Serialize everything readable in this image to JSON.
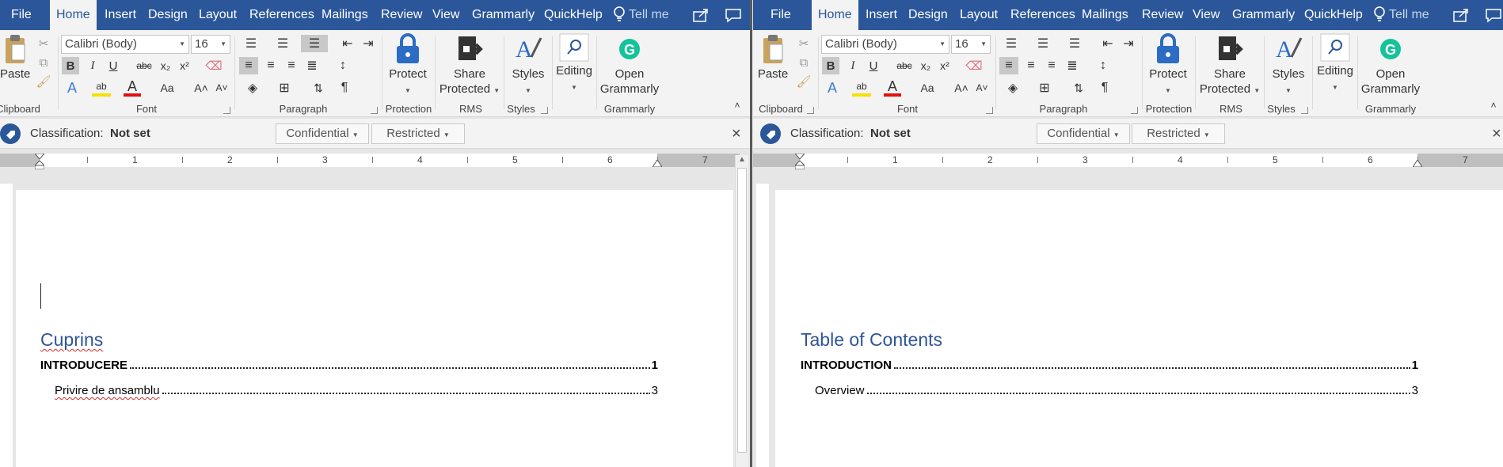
{
  "windows": [
    {
      "menu": {
        "file": "File",
        "tabs": [
          "Home",
          "Insert",
          "Design",
          "Layout",
          "References",
          "Mailings",
          "Review",
          "View",
          "Grammarly",
          "QuickHelp"
        ],
        "tell": "Tell me"
      },
      "ribbon": {
        "paste": "Paste",
        "font_name": "Calibri (Body)",
        "font_size": "16",
        "groups": {
          "clipboard": "Clipboard",
          "font": "Font",
          "paragraph": "Paragraph",
          "protection": "Protection",
          "rms": "RMS",
          "styles": "Styles",
          "grammarly": "Grammarly"
        },
        "protect": "Protect",
        "share1": "Share",
        "share2": "Protected",
        "styles_btn": "Styles",
        "editing": "Editing",
        "open1": "Open",
        "open2": "Grammarly"
      },
      "classification": {
        "label": "Classification:",
        "value": "Not set",
        "btn1": "Confidential",
        "btn2": "Restricted"
      },
      "ruler": [
        "1",
        "2",
        "3",
        "4",
        "5",
        "6",
        "7"
      ],
      "toc": {
        "title": "Cuprins",
        "entries": [
          {
            "text": "INTRODUCERE",
            "page": "1"
          },
          {
            "text": "Privire de ansamblu",
            "page": "3"
          }
        ]
      }
    },
    {
      "menu": {
        "file": "File",
        "tabs": [
          "Home",
          "Insert",
          "Design",
          "Layout",
          "References",
          "Mailings",
          "Review",
          "View",
          "Grammarly",
          "QuickHelp"
        ],
        "tell": "Tell me"
      },
      "ribbon": {
        "paste": "Paste",
        "font_name": "Calibri (Body)",
        "font_size": "16",
        "groups": {
          "clipboard": "Clipboard",
          "font": "Font",
          "paragraph": "Paragraph",
          "protection": "Protection",
          "rms": "RMS",
          "styles": "Styles",
          "grammarly": "Grammarly"
        },
        "protect": "Protect",
        "share1": "Share",
        "share2": "Protected",
        "styles_btn": "Styles",
        "editing": "Editing",
        "open1": "Open",
        "open2": "Grammarly"
      },
      "classification": {
        "label": "Classification:",
        "value": "Not set",
        "btn1": "Confidential",
        "btn2": "Restricted"
      },
      "ruler": [
        "1",
        "2",
        "3",
        "4",
        "5",
        "6",
        "7"
      ],
      "toc": {
        "title": "Table of Contents",
        "entries": [
          {
            "text": "INTRODUCTION",
            "page": "1"
          },
          {
            "text": "Overview",
            "page": "3"
          }
        ]
      }
    }
  ],
  "colors": {
    "word_blue": "#2b579a",
    "heading_blue": "#2f5597",
    "ribbon_bg": "#f3f3f3"
  },
  "icons": [
    "paste-icon",
    "cut-icon",
    "copy-icon",
    "format-painter-icon",
    "bold-icon",
    "italic-icon",
    "underline-icon",
    "strikethrough-icon",
    "subscript-icon",
    "superscript-icon",
    "clear-format-icon",
    "text-effects-icon",
    "highlight-icon",
    "font-color-icon",
    "change-case-icon",
    "grow-font-icon",
    "shrink-font-icon",
    "bullets-icon",
    "numbering-icon",
    "multilevel-icon",
    "decrease-indent-icon",
    "increase-indent-icon",
    "align-left-icon",
    "center-icon",
    "align-right-icon",
    "justify-icon",
    "line-spacing-icon",
    "shading-icon",
    "borders-icon",
    "sort-icon",
    "pilcrow-icon",
    "lock-icon",
    "share-protected-icon",
    "styles-icon",
    "search-icon",
    "grammarly-icon",
    "lightbulb-icon",
    "share-icon",
    "comments-icon",
    "tag-icon",
    "close-icon"
  ]
}
